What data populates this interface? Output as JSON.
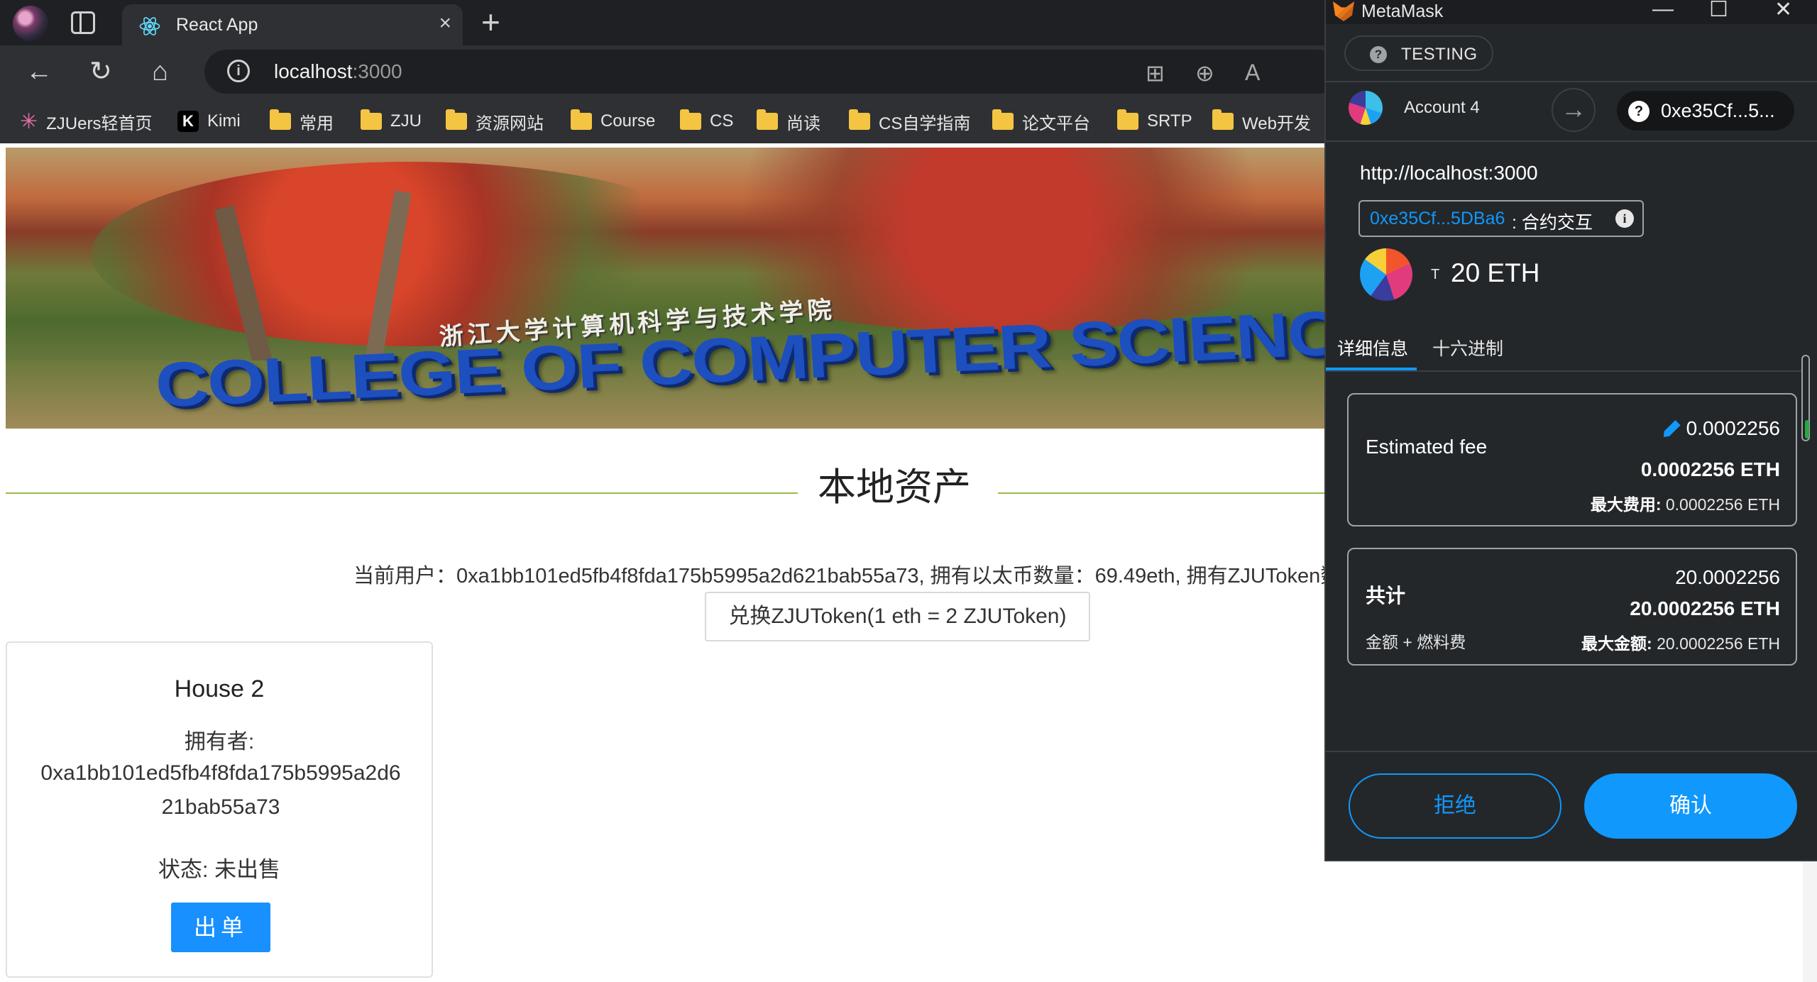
{
  "browser": {
    "tab_title": "React App",
    "url_host": "localhost",
    "url_port": ":3000",
    "bookmarks": [
      "ZJUers轻首页",
      "Kimi",
      "常用",
      "ZJU",
      "资源网站",
      "Course",
      "CS",
      "尚读",
      "CS自学指南",
      "论文平台",
      "SRTP",
      "Web开发"
    ]
  },
  "page": {
    "banner_cn": "浙江大学计算机科学与技术学院",
    "banner_en": "COLLEGE OF COMPUTER SCIENCE",
    "section_title": "本地资产",
    "user_line": "当前用户：0xa1bb101ed5fb4f8fda175b5995a2d621bab55a73, 拥有以太币数量：69.49eth, 拥有ZJUToken数量：",
    "exchange_button": "兑换ZJUToken(1 eth = 2 ZJUToken)",
    "card": {
      "title": "House 2",
      "owner_label": "拥有者:",
      "owner": "0xa1bb101ed5fb4f8fda175b5995a2d621bab55a73",
      "status": "状态: 未出售",
      "sell_button": "出单"
    }
  },
  "metamask": {
    "app_title": "MetaMask",
    "network": "TESTING",
    "account_name": "Account 4",
    "contract_short": "0xe35Cf...5...",
    "origin": "http://localhost:3000",
    "contract_chip_addr": "0xe35Cf...5DBa6",
    "contract_chip_type": ": 合约交互",
    "amount_prefix": "T",
    "amount": "20 ETH",
    "tabs": [
      "详细信息",
      "十六进制"
    ],
    "fee": {
      "label": "Estimated fee",
      "value": "0.0002256",
      "value_eth": "0.0002256 ETH",
      "max_label": "最大费用:",
      "max_value": "0.0002256 ETH"
    },
    "total": {
      "label": "共计",
      "sub_label": "金额 + 燃料费",
      "value": "20.0002256",
      "value_eth": "20.0002256 ETH",
      "max_label": "最大金额:",
      "max_value": "20.0002256 ETH"
    },
    "reject_button": "拒绝",
    "confirm_button": "确认"
  },
  "colors": {
    "metamask_bg": "#24272a",
    "metamask_accent": "#1098fc",
    "antd_primary": "#1890ff",
    "divider_green": "#9bba4a",
    "browser_chrome": "#2f3034"
  }
}
